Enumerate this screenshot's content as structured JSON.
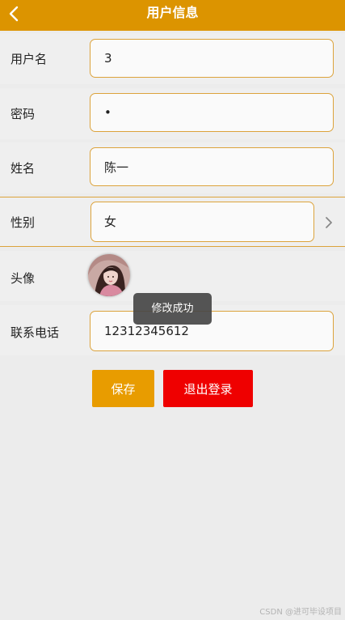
{
  "header": {
    "title": "用户信息",
    "back_icon": "chevron-left-icon",
    "background_color": "#dc9400"
  },
  "form": {
    "username": {
      "label": "用户名",
      "value": "3"
    },
    "password": {
      "label": "密码",
      "value": "•"
    },
    "name": {
      "label": "姓名",
      "value": "陈一"
    },
    "gender": {
      "label": "性别",
      "value": "女",
      "icon": "chevron-right-icon"
    },
    "avatar": {
      "label": "头像"
    },
    "phone": {
      "label": "联系电话",
      "value": "12312345612"
    }
  },
  "toast": {
    "message": "修改成功"
  },
  "actions": {
    "save_label": "保存",
    "logout_label": "退出登录",
    "save_color": "#e89c00",
    "logout_color": "#ef0000"
  },
  "watermark": {
    "text": "CSDN @进可毕设项目"
  },
  "colors": {
    "accent": "#dc9400",
    "field_border": "#dca33c"
  }
}
